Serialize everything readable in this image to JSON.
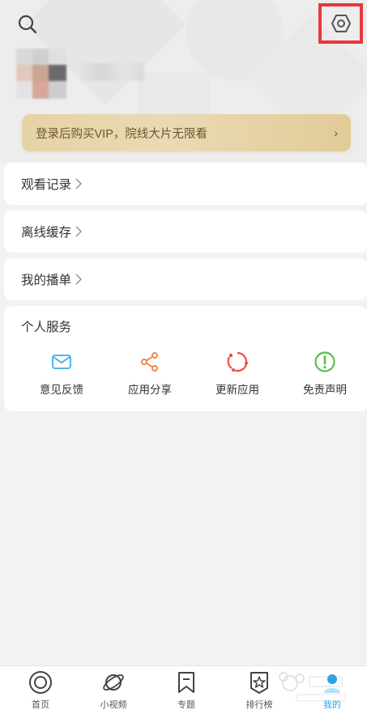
{
  "header": {
    "search_icon": "search-icon",
    "settings_icon": "settings-hexagon-icon"
  },
  "vip_banner": {
    "text": "登录后购买VIP，院线大片无限看",
    "chevron": "›"
  },
  "menu": {
    "history": "观看记录",
    "offline_cache": "离线缓存",
    "my_playlist": "我的播单"
  },
  "services": {
    "title": "个人服务",
    "items": [
      {
        "label": "意见反馈",
        "icon": "mail-icon",
        "color": "#4fb6ee"
      },
      {
        "label": "应用分享",
        "icon": "share-icon",
        "color": "#f0884a"
      },
      {
        "label": "更新应用",
        "icon": "refresh-icon",
        "color": "#ee4b4b"
      },
      {
        "label": "免责声明",
        "icon": "alert-icon",
        "color": "#55c14a"
      }
    ]
  },
  "tabbar": {
    "tabs": [
      {
        "label": "首页",
        "icon": "home-icon"
      },
      {
        "label": "小视频",
        "icon": "planet-icon"
      },
      {
        "label": "专题",
        "icon": "bookmark-icon"
      },
      {
        "label": "排行榜",
        "icon": "rank-star-icon"
      },
      {
        "label": "我的",
        "icon": "profile-icon"
      }
    ],
    "active_color": "#2aa4e8"
  }
}
